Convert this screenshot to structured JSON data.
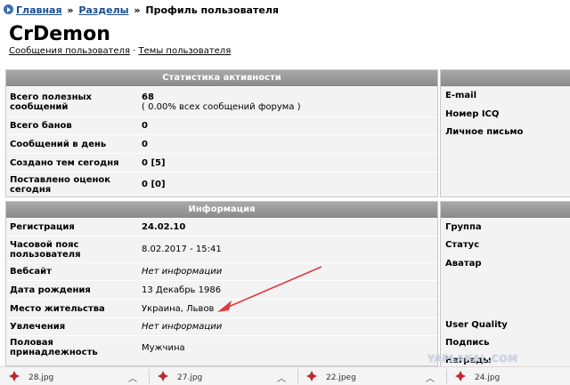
{
  "breadcrumb": {
    "home": "Главная",
    "sep1": "»",
    "sections": "Разделы",
    "sep2": "»",
    "current": "Профиль пользователя"
  },
  "profile": {
    "username": "CrDemon",
    "link_posts": "Сообщения пользователя",
    "link_sep": "·",
    "link_topics": "Темы пользователя"
  },
  "activity": {
    "title": "Статистика активности",
    "rows": [
      {
        "label": "Всего полезных сообщений",
        "value": "68",
        "note": "( 0.00% всех сообщений форума )"
      },
      {
        "label": "Всего банов",
        "value": "0"
      },
      {
        "label": "Сообщений в день",
        "value": "0"
      },
      {
        "label": "Создано тем сегодня",
        "value": "0 [5]"
      },
      {
        "label": "Поставлено оценок сегодня",
        "value": "0 [0]"
      }
    ]
  },
  "info": {
    "title": "Информация",
    "rows": [
      {
        "label": "Регистрация",
        "value": "24.02.10"
      },
      {
        "label": "Часовой пояс пользователя",
        "value": "8.02.2017 - 15:41"
      },
      {
        "label": "Вебсайт",
        "value": "Нет информации"
      },
      {
        "label": "Дата рождения",
        "value": "13 Декабрь 1986"
      },
      {
        "label": "Место жительства",
        "value": "Украина, Львов"
      },
      {
        "label": "Увлечения",
        "value": "Нет информации"
      },
      {
        "label": "Половая принадлежность",
        "value": "Мужчина"
      }
    ]
  },
  "contacts": {
    "email": "E-mail",
    "icq": "Номер ICQ",
    "pm": "Личное письмо"
  },
  "side_info": {
    "group": "Группа",
    "status": "Статус",
    "avatar": "Аватар",
    "quality": "User Quality",
    "signature": "Подпись",
    "awards": "Награды"
  },
  "watermark": "YAPLAKAL.COM",
  "downloads": [
    {
      "name": "28.jpg"
    },
    {
      "name": "27.jpg"
    },
    {
      "name": "22.jpeg"
    },
    {
      "name": "24.jpg"
    }
  ],
  "colors": {
    "link": "#1a4d8f",
    "header_bg": "#9a9a9a",
    "panel_bg": "#f3f3f3",
    "annotation_arrow": "#e0393e"
  }
}
